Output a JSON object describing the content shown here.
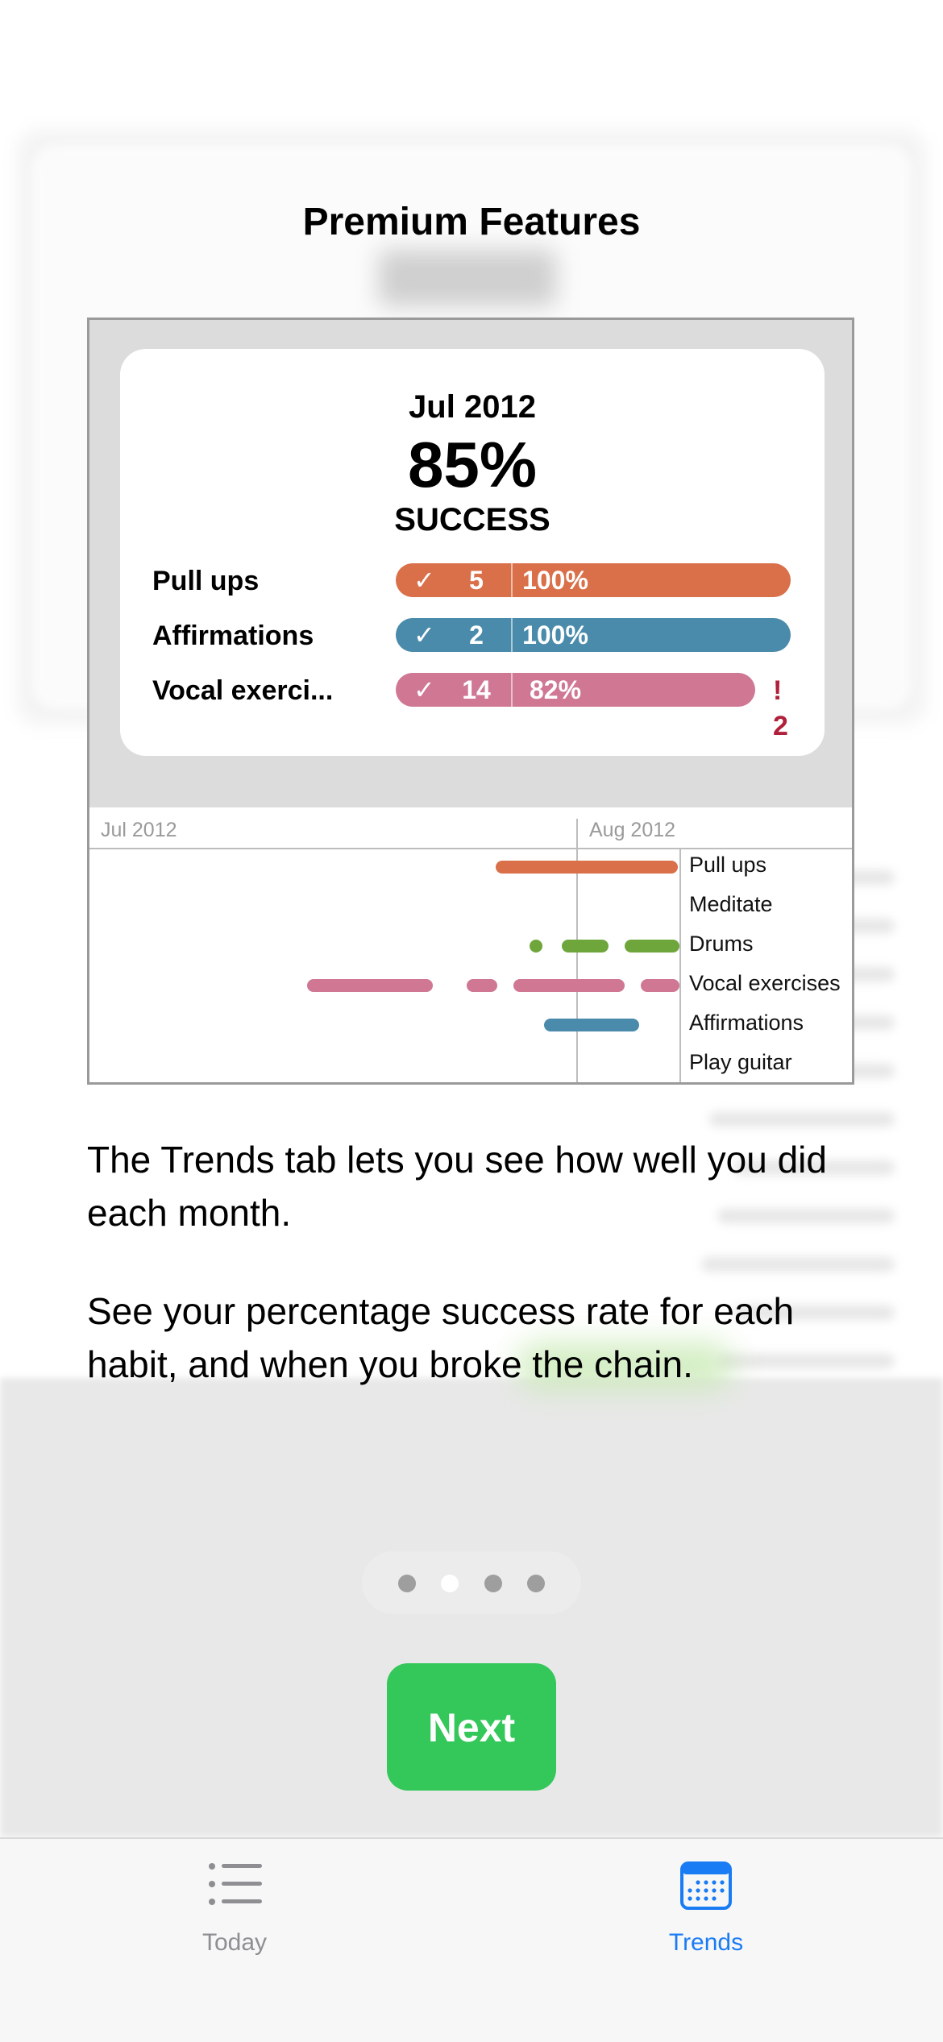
{
  "modal": {
    "title": "Premium Features",
    "promo": {
      "month": "Jul 2012",
      "percent": "85%",
      "label": "SUCCESS",
      "habits": [
        {
          "name": "Pull ups",
          "check": "✓",
          "count": "5",
          "percent": "100%",
          "color": "#d9704a",
          "extra": ""
        },
        {
          "name": "Affirmations",
          "check": "✓",
          "count": "2",
          "percent": "100%",
          "color": "#4a8bab",
          "extra": ""
        },
        {
          "name": "Vocal exerci...",
          "check": "✓",
          "count": "14",
          "percent": "82%",
          "color": "#cf7793",
          "extra": "! 2"
        }
      ],
      "timeline": {
        "months": [
          "Jul 2012",
          "Aug 2012"
        ],
        "rows": [
          {
            "label": "Pull ups",
            "color": "#d9704a"
          },
          {
            "label": "Meditate",
            "color": "#000000"
          },
          {
            "label": "Drums",
            "color": "#6fa63c"
          },
          {
            "label": "Vocal exercises",
            "color": "#cf7793"
          },
          {
            "label": "Affirmations",
            "color": "#4a8bab"
          },
          {
            "label": "Play guitar",
            "color": "#000000"
          }
        ]
      }
    },
    "paragraph1": "The Trends tab lets you see how well you did each month.",
    "paragraph2": "See your percentage success rate for each habit, and when you broke the chain.",
    "page_indicator": {
      "count": 4,
      "active": 2
    },
    "next_label": "Next"
  },
  "tabbar": {
    "tabs": [
      {
        "label": "Today",
        "icon": "list-icon",
        "active": false
      },
      {
        "label": "Trends",
        "icon": "calendar-icon",
        "active": true
      }
    ],
    "active_color": "#1a7cf5",
    "inactive_color": "#8e8e93"
  }
}
